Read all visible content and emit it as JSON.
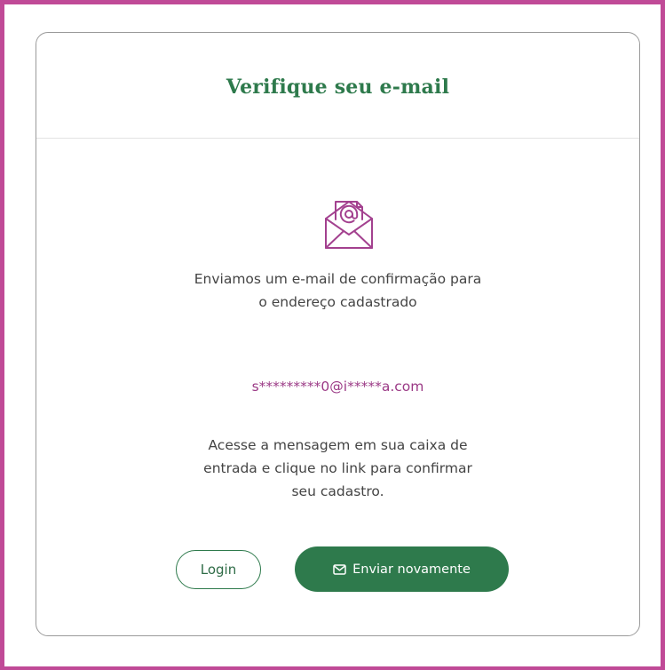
{
  "card": {
    "title": "Verifique seu e-mail"
  },
  "icons": {
    "hero": "open-envelope-at-icon",
    "resend": "envelope-icon"
  },
  "message_intro": {
    "line1": "Enviamos um e-mail de confirmação para",
    "line2": "o endereço cadastrado"
  },
  "email_masked": "s*********0@i*****a.com",
  "message_instructions": {
    "line1": "Acesse a mensagem em sua caixa de",
    "line2": "entrada e clique no link para confirmar",
    "line3": "seu cadastro."
  },
  "buttons": {
    "login_label": "Login",
    "resend_label": "Enviar novamente"
  },
  "colors": {
    "brand_green": "#2e7a4c",
    "accent_magenta": "#9b3a86",
    "frame_border": "#c04a97"
  }
}
